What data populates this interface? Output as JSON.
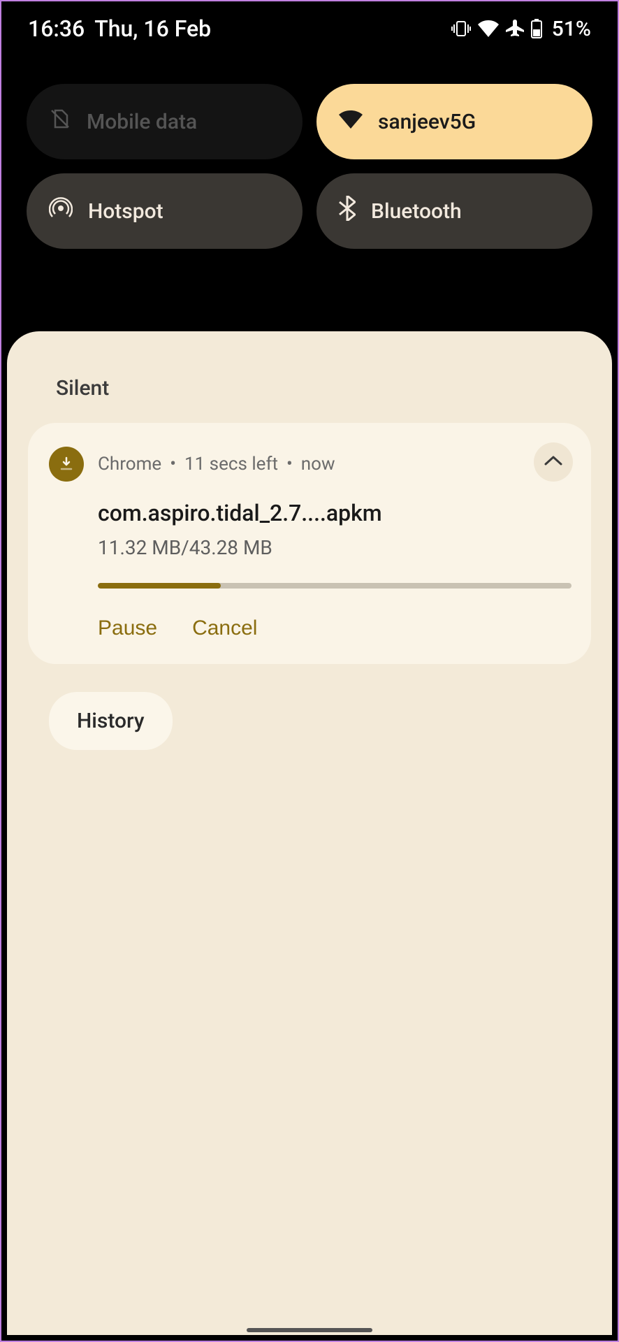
{
  "status": {
    "time": "16:36",
    "date": "Thu, 16 Feb",
    "battery_percent": "51%"
  },
  "qs": {
    "mobile_data": {
      "label": "Mobile data"
    },
    "wifi": {
      "label": "sanjeev5G"
    },
    "hotspot": {
      "label": "Hotspot"
    },
    "bluetooth": {
      "label": "Bluetooth"
    }
  },
  "shade": {
    "section_label": "Silent",
    "history_label": "History"
  },
  "notification": {
    "app": "Chrome",
    "time_hint": "11 secs left",
    "timestamp": "now",
    "title": "com.aspiro.tidal_2.7....apkm",
    "subtitle": "11.32 MB/43.28 MB",
    "progress_percent": 26,
    "actions": {
      "pause": "Pause",
      "cancel": "Cancel"
    }
  }
}
